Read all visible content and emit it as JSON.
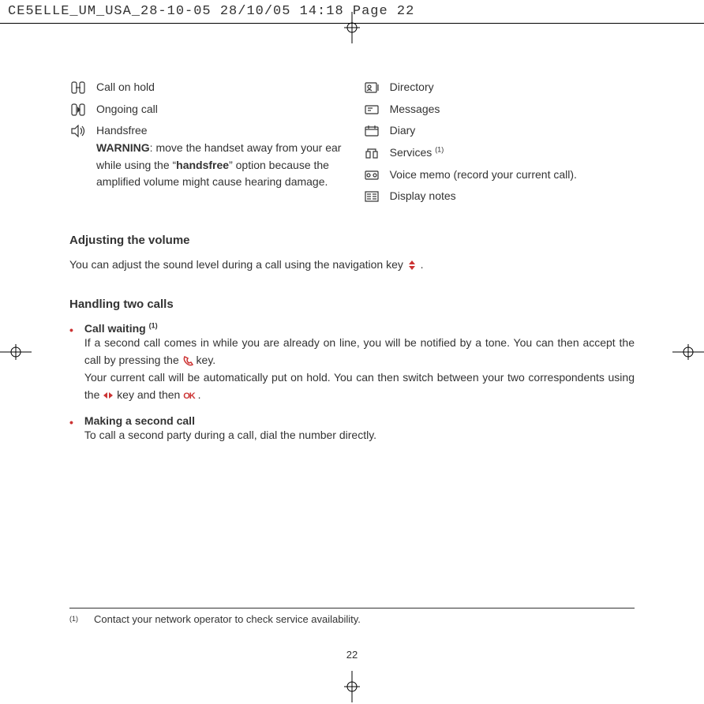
{
  "header": "CE5ELLE_UM_USA_28-10-05  28/10/05  14:18  Page 22",
  "left_items": [
    {
      "label": "Call on hold"
    },
    {
      "label": "Ongoing call"
    },
    {
      "label": "Handsfree"
    }
  ],
  "warning": {
    "prefix": "WARNING",
    "text1": ": move the handset away from your ear while using the “",
    "bold2": "handsfree",
    "text2": "” option because the amplified volume might cause hearing damage."
  },
  "right_items": [
    {
      "label": "Directory"
    },
    {
      "label": "Messages"
    },
    {
      "label": "Diary"
    },
    {
      "label": "Services ",
      "sup": "(1)"
    },
    {
      "label": "Voice memo (record your current call)."
    },
    {
      "label": "Display notes"
    }
  ],
  "sections": {
    "adjusting": {
      "title": "Adjusting the volume",
      "body": "You can adjust the sound level during a call using the navigation key "
    },
    "handling": {
      "title": "Handling two calls"
    },
    "call_waiting": {
      "title": "Call waiting ",
      "sup": "(1)",
      "p1a": "If a second call comes in while you are already on line, you will be notified by a tone. You can then accept the call by pressing the ",
      "p1b": " key.",
      "p2a": "Your current call will be automatically put on hold. You can then switch between your two correspondents using the ",
      "p2b": " key and then ",
      "ok": "OK",
      "p2c": " ."
    },
    "second_call": {
      "title": "Making a second call",
      "body": "To call a second party during a call, dial the number directly."
    }
  },
  "footnote": {
    "sup": "(1)",
    "text": "Contact your network operator to check service availability."
  },
  "page_number": "22"
}
